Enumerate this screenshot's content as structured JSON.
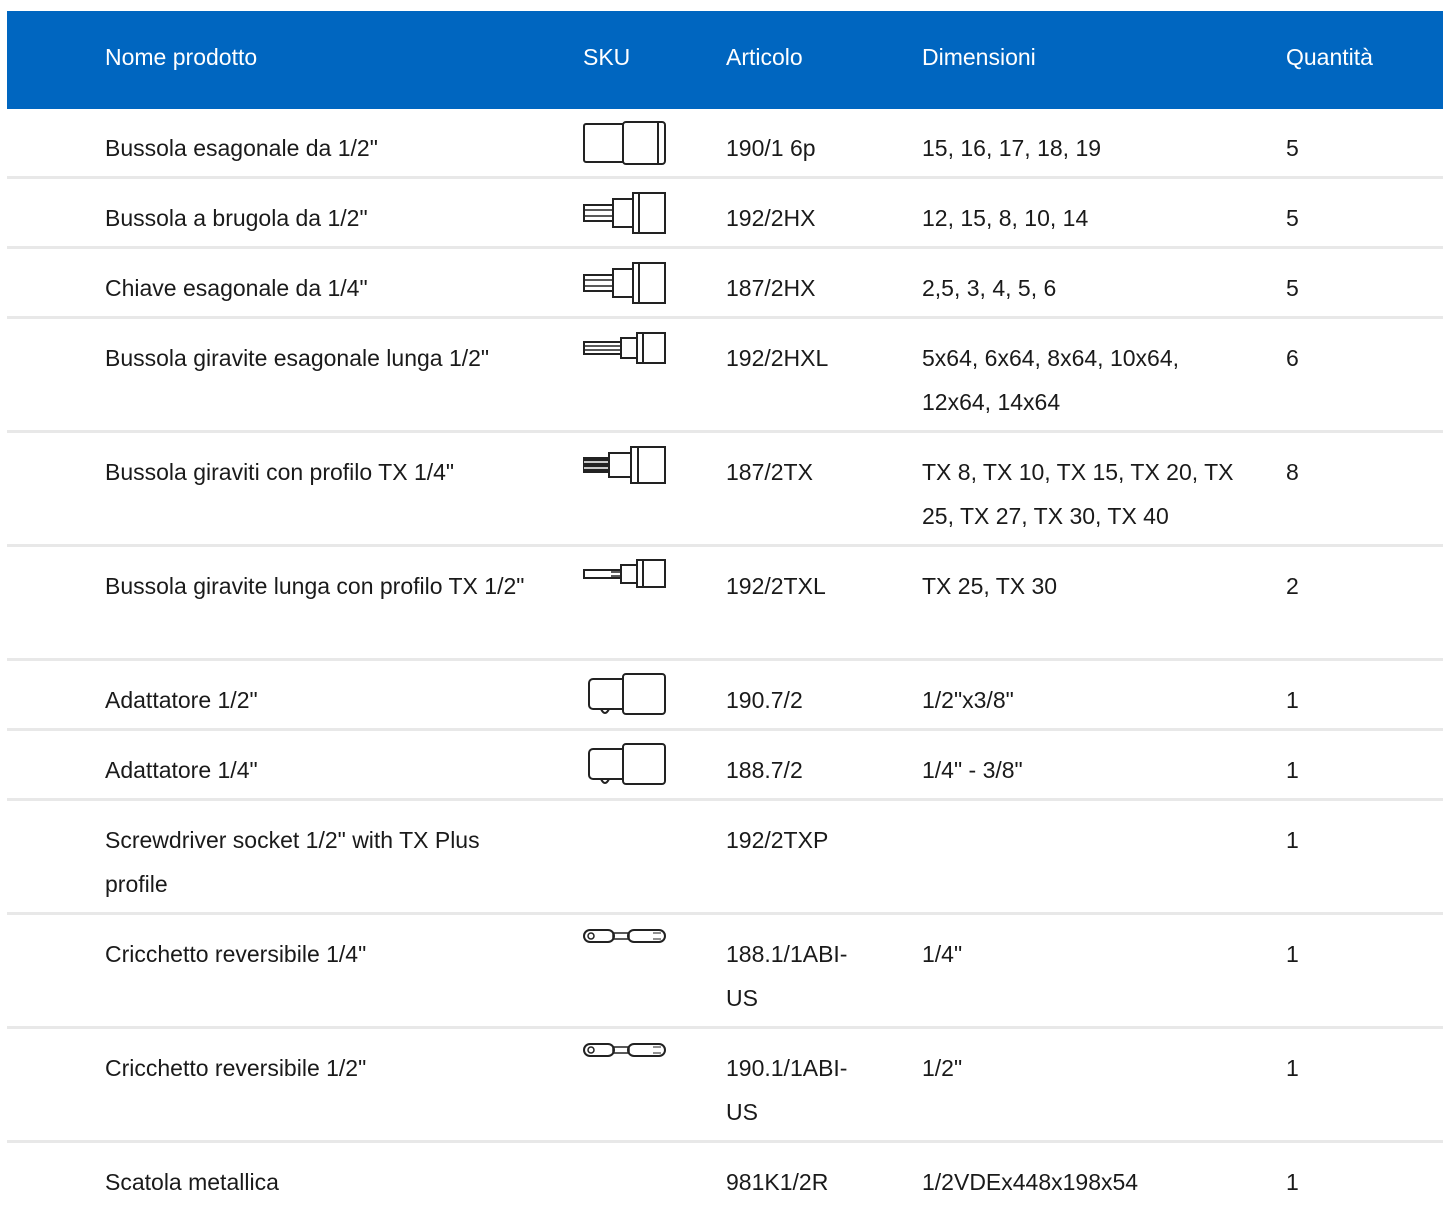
{
  "table": {
    "headers": {
      "name": "Nome prodotto",
      "sku": "SKU",
      "article": "Articolo",
      "dimensions": "Dimensioni",
      "quantity": "Quantità"
    },
    "accent_color": "#0066c0",
    "rows": [
      {
        "name": "Bussola esagonale da 1/2\"",
        "icon": "hex-socket-icon",
        "article": "190/1 6p",
        "dimensions": "15, 16, 17, 18, 19",
        "quantity": "5"
      },
      {
        "name": "Bussola a brugola da 1/2\"",
        "icon": "allen-socket-icon",
        "article": "192/2HX",
        "dimensions": "12, 15, 8, 10, 14",
        "quantity": "5"
      },
      {
        "name": "Chiave esagonale da 1/4\"",
        "icon": "hex-key-socket-icon",
        "article": "187/2HX",
        "dimensions": "2,5, 3, 4, 5, 6",
        "quantity": "5"
      },
      {
        "name": "Bussola giravite esagonale lunga 1/2\"",
        "icon": "long-hex-bit-socket-icon",
        "article": "192/2HXL",
        "dimensions": "5x64, 6x64, 8x64, 10x64, 12x64, 14x64",
        "quantity": "6"
      },
      {
        "name": "Bussola giraviti con profilo TX 1/4\"",
        "icon": "torx-bit-socket-icon",
        "article": "187/2TX",
        "dimensions": "TX 8, TX 10, TX 15, TX 20, TX 25, TX 27, TX 30, TX 40",
        "quantity": "8"
      },
      {
        "name": "Bussola giravite lunga con profilo TX 1/2\"",
        "icon": "long-torx-bit-socket-icon",
        "article": "192/2TXL",
        "dimensions": "TX 25, TX 30",
        "quantity": "2"
      },
      {
        "name": "Adattatore 1/2\"",
        "icon": "adapter-icon",
        "article": "190.7/2",
        "dimensions": "1/2\"x3/8\"",
        "quantity": "1"
      },
      {
        "name": "Adattatore 1/4\"",
        "icon": "adapter-icon",
        "article": "188.7/2",
        "dimensions": "1/4\" - 3/8\"",
        "quantity": "1"
      },
      {
        "name": "Screwdriver socket 1/2\" with TX Plus profile",
        "icon": "",
        "article": "192/2TXP",
        "dimensions": "",
        "quantity": "1"
      },
      {
        "name": "Cricchetto reversibile 1/4\"",
        "icon": "ratchet-icon",
        "article": "188.1/1ABI-US",
        "dimensions": "1/4\"",
        "quantity": "1"
      },
      {
        "name": "Cricchetto reversibile 1/2\"",
        "icon": "ratchet-icon",
        "article": "190.1/1ABI-US",
        "dimensions": "1/2\"",
        "quantity": "1"
      },
      {
        "name": "Scatola metallica",
        "icon": "",
        "article": "981K1/2R",
        "dimensions": "1/2VDEx448x198x54",
        "quantity": "1"
      }
    ]
  }
}
